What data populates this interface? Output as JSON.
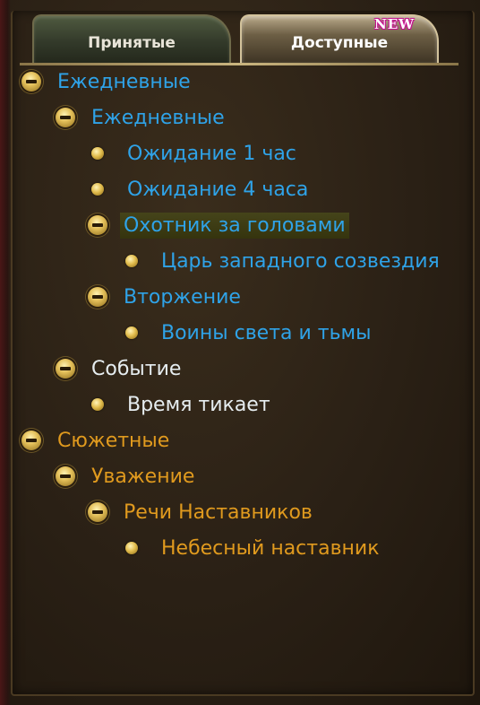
{
  "tabs": {
    "accepted_label": "Принятые",
    "available_label": "Доступные",
    "new_badge": "NEW"
  },
  "colors": {
    "category_blue": "#2fa3e8",
    "event_white": "#e6edf0",
    "story_orange": "#e09a1e"
  },
  "tree": {
    "daily_root": "Ежедневные",
    "daily_sub": "Ежедневные",
    "wait_1h": "Ожидание 1 час",
    "wait_4h": "Ожидание 4 часа",
    "bounty_hunter": "Охотник за головами",
    "western_king": "Царь западного созвездия",
    "invasion": "Вторжение",
    "warriors": "Воины света и тьмы",
    "event": "Событие",
    "time_ticks": "Время тикает",
    "story_root": "Сюжетные",
    "respect": "Уважение",
    "mentors_speech": "Речи Наставников",
    "heavenly_mentor": "Небесный наставник"
  }
}
